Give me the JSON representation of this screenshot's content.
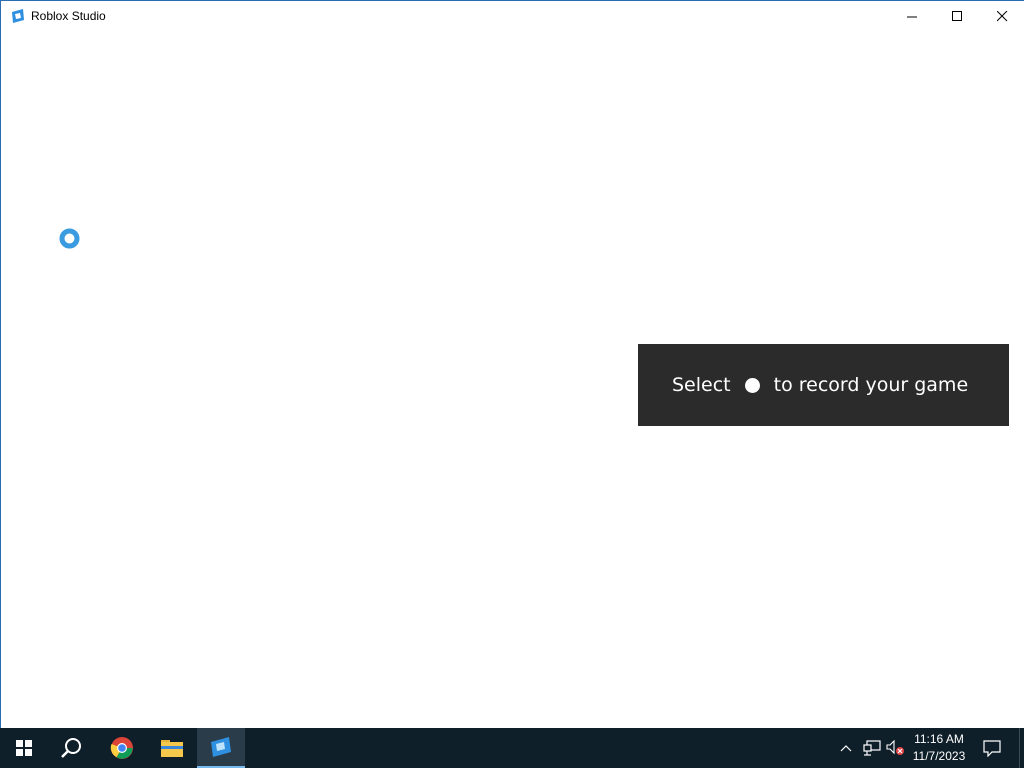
{
  "window": {
    "title": "Roblox Studio",
    "icon": "roblox-studio-icon",
    "controls": {
      "minimize": "minimize-icon",
      "maximize": "maximize-icon",
      "close": "close-icon"
    }
  },
  "content": {
    "loading_indicator": "loading-spinner-icon",
    "toast": {
      "text_before": "Select",
      "record_icon": "record-dot-icon",
      "text_after": "to record your game"
    }
  },
  "taskbar": {
    "items": [
      "start-icon",
      "search-icon",
      "chrome-icon",
      "file-explorer-icon",
      "roblox-studio-icon"
    ],
    "tray": {
      "icons": [
        "chevron-up-icon",
        "network-icon",
        "volume-muted-icon"
      ],
      "time": "11:16 AM",
      "date": "11/7/2023",
      "notification_icon": "notification-icon"
    }
  },
  "colors": {
    "accent": "#2b6cb0",
    "toast_bg": "#2b2b2b",
    "taskbar_bg": "#0f1f2a",
    "spinner": "#3a9be0"
  }
}
